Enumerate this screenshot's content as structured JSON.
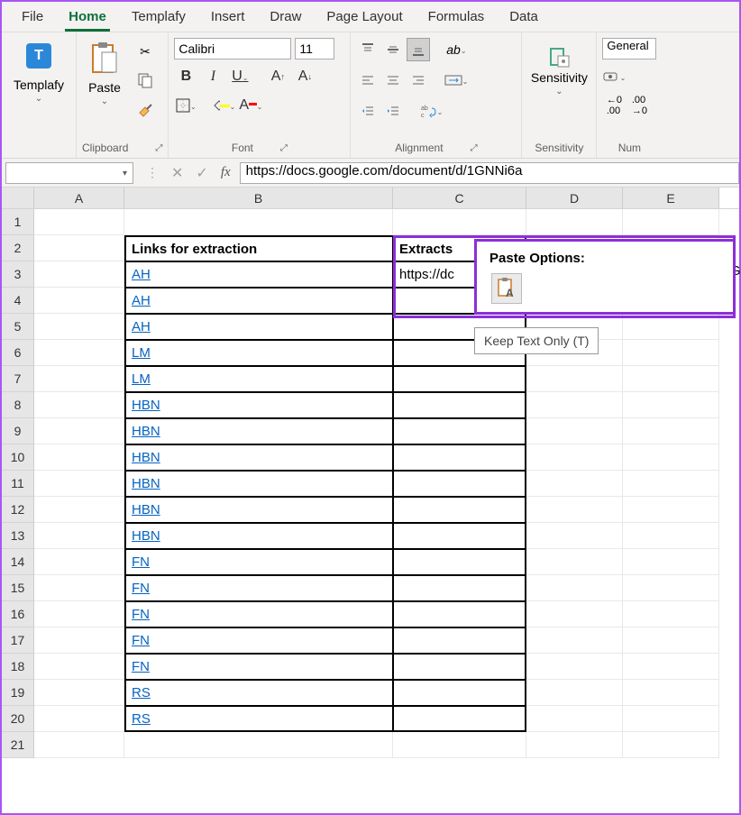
{
  "tabs": [
    "File",
    "Home",
    "Templafy",
    "Insert",
    "Draw",
    "Page Layout",
    "Formulas",
    "Data"
  ],
  "active_tab": "Home",
  "ribbon": {
    "templafy": {
      "label": "Templafy"
    },
    "clipboard": {
      "paste": "Paste",
      "group": "Clipboard"
    },
    "font": {
      "name": "Calibri",
      "size": "11",
      "group": "Font"
    },
    "alignment": {
      "group": "Alignment"
    },
    "sensitivity": {
      "label": "Sensitivity",
      "group": "Sensitivity"
    },
    "number": {
      "format": "General",
      "group": "Num"
    }
  },
  "formula_bar": "https://docs.google.com/document/d/1GNNi6a",
  "name_box": "",
  "columns": [
    "A",
    "B",
    "C",
    "D",
    "E"
  ],
  "rows": [
    {
      "n": 1,
      "B": "",
      "C": ""
    },
    {
      "n": 2,
      "B": "Links for extraction",
      "C": "Extracts",
      "header": true
    },
    {
      "n": 3,
      "B": "AH",
      "C": "https://dc",
      "link": true
    },
    {
      "n": 4,
      "B": "AH",
      "link": true
    },
    {
      "n": 5,
      "B": "AH",
      "link": true
    },
    {
      "n": 6,
      "B": "LM",
      "link": true
    },
    {
      "n": 7,
      "B": "LM",
      "link": true
    },
    {
      "n": 8,
      "B": "HBN",
      "link": true
    },
    {
      "n": 9,
      "B": "HBN",
      "link": true
    },
    {
      "n": 10,
      "B": "HBN",
      "link": true
    },
    {
      "n": 11,
      "B": "HBN",
      "link": true
    },
    {
      "n": 12,
      "B": "HBN",
      "link": true
    },
    {
      "n": 13,
      "B": "HBN",
      "link": true
    },
    {
      "n": 14,
      "B": "FN",
      "link": true
    },
    {
      "n": 15,
      "B": "FN",
      "link": true
    },
    {
      "n": 16,
      "B": "FN",
      "link": true
    },
    {
      "n": 17,
      "B": "FN",
      "link": true
    },
    {
      "n": 18,
      "B": "FN",
      "link": true
    },
    {
      "n": 19,
      "B": "RS",
      "link": true
    },
    {
      "n": 20,
      "B": "RS",
      "link": true
    },
    {
      "n": 21,
      "B": ""
    }
  ],
  "paste_popup": {
    "title": "Paste Options:",
    "tooltip": "Keep Text Only (T)"
  },
  "overflow_g": "G"
}
